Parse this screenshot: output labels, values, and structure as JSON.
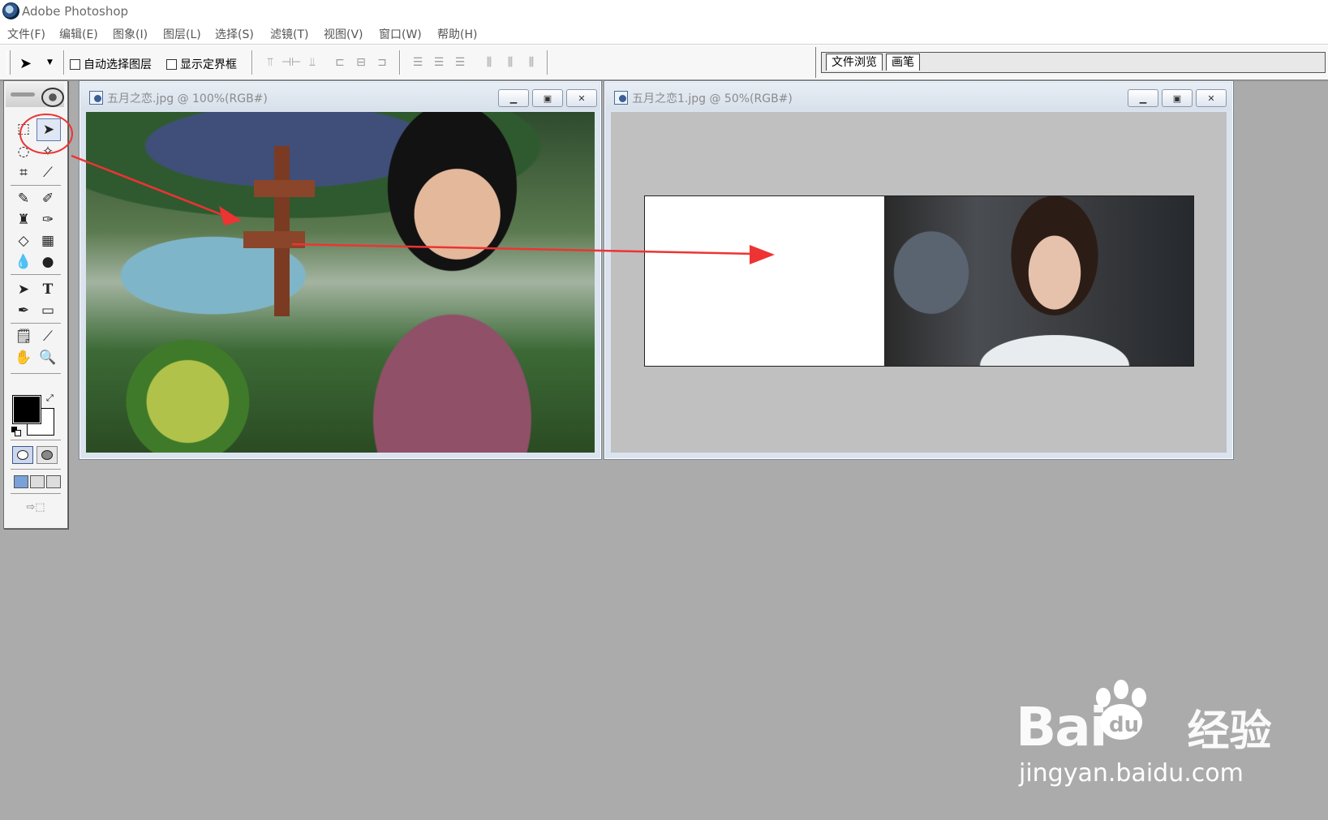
{
  "window": {
    "title": "Adobe Photoshop"
  },
  "menu": [
    "文件(F)",
    "编辑(E)",
    "图象(I)",
    "图层(L)",
    "选择(S)",
    "滤镜(T)",
    "视图(V)",
    "窗口(W)",
    "帮助(H)"
  ],
  "options": {
    "auto_select_label": "自动选择图层",
    "show_bounds_label": "显示定界框"
  },
  "palette_well": {
    "tabs": [
      "文件浏览",
      "画笔"
    ]
  },
  "documents": [
    {
      "title": "五月之恋.jpg @ 100%(RGB#)"
    },
    {
      "title": "五月之恋1.jpg @ 50%(RGB#)"
    }
  ],
  "toolbox": {
    "tools": [
      "marquee-tool",
      "move-tool",
      "lasso-tool",
      "magic-wand-tool",
      "crop-tool",
      "slice-tool",
      "healing-brush-tool",
      "brush-tool",
      "clone-stamp-tool",
      "history-brush-tool",
      "eraser-tool",
      "gradient-tool",
      "blur-tool",
      "dodge-tool",
      "path-selection-tool",
      "type-tool",
      "pen-tool",
      "shape-tool",
      "notes-tool",
      "eyedropper-tool",
      "hand-tool",
      "zoom-tool"
    ],
    "foreground_color": "#000000",
    "background_color": "#ffffff"
  },
  "annotation": {
    "color": "#ee3333"
  },
  "watermark": {
    "logo": "Bai",
    "logo_tail": "经验",
    "url": "jingyan.baidu.com"
  }
}
